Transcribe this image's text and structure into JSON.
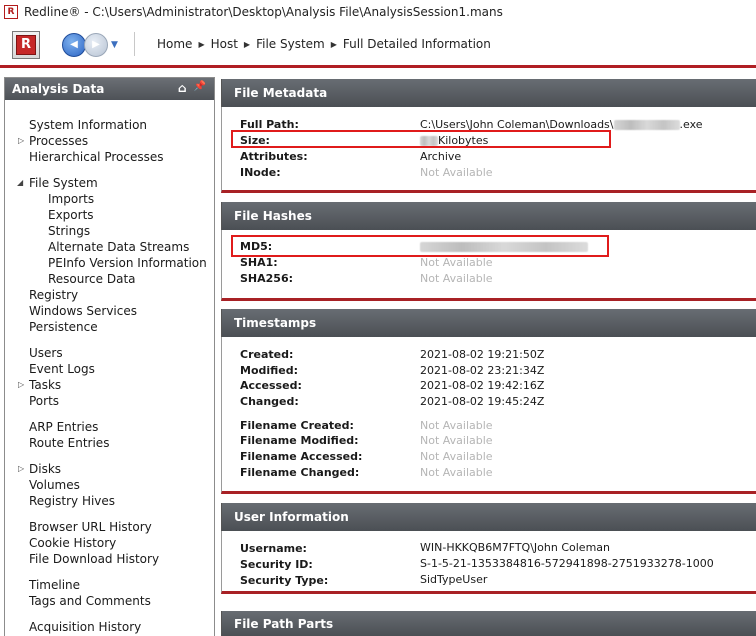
{
  "window": {
    "title": "Redline® - C:\\Users\\Administrator\\Desktop\\Analysis File\\AnalysisSession1.mans",
    "icon_letter": "R"
  },
  "toolbar": {
    "logo_letter": "R",
    "back_glyph": "◀",
    "forward_glyph": "▶",
    "dropdown_glyph": "▼",
    "breadcrumb": [
      "Home",
      "Host",
      "File System",
      "Full Detailed Information"
    ],
    "breadcrumb_sep": "▶"
  },
  "left_panel": {
    "title": "Analysis Data",
    "home_icon": "⌂",
    "pin_icon": "📌",
    "items": [
      {
        "label": "System Information"
      },
      {
        "label": "Processes",
        "expander": "▷"
      },
      {
        "label": "Hierarchical Processes"
      },
      {
        "label": "File System",
        "expander": "◢"
      },
      {
        "label": "Imports"
      },
      {
        "label": "Exports"
      },
      {
        "label": "Strings"
      },
      {
        "label": "Alternate Data Streams"
      },
      {
        "label": "PEInfo Version Information"
      },
      {
        "label": "Resource Data"
      },
      {
        "label": "Registry"
      },
      {
        "label": "Windows Services"
      },
      {
        "label": "Persistence"
      },
      {
        "label": "Users"
      },
      {
        "label": "Event Logs"
      },
      {
        "label": "Tasks",
        "expander": "▷"
      },
      {
        "label": "Ports"
      },
      {
        "label": "ARP Entries"
      },
      {
        "label": "Route Entries"
      },
      {
        "label": "Disks",
        "expander": "▷"
      },
      {
        "label": "Volumes"
      },
      {
        "label": "Registry Hives"
      },
      {
        "label": "Browser URL History"
      },
      {
        "label": "Cookie History"
      },
      {
        "label": "File Download History"
      },
      {
        "label": "Timeline"
      },
      {
        "label": "Tags and Comments"
      },
      {
        "label": "Acquisition History"
      }
    ]
  },
  "sections": {
    "metadata": {
      "title": "File Metadata",
      "full_path_label": "Full Path:",
      "full_path_prefix": "C:\\Users\\John Coleman\\Downloads\\",
      "full_path_suffix": ".exe",
      "size_label": "Size:",
      "size_unit": "Kilobytes",
      "attributes_label": "Attributes:",
      "attributes_value": "Archive",
      "inode_label": "INode:",
      "inode_value": "Not Available"
    },
    "hashes": {
      "title": "File Hashes",
      "md5_label": "MD5:",
      "sha1_label": "SHA1:",
      "sha1_value": "Not Available",
      "sha256_label": "SHA256:",
      "sha256_value": "Not Available"
    },
    "timestamps": {
      "title": "Timestamps",
      "created_label": "Created:",
      "created_value": "2021-08-02 19:21:50Z",
      "modified_label": "Modified:",
      "modified_value": "2021-08-02 23:21:34Z",
      "accessed_label": "Accessed:",
      "accessed_value": "2021-08-02 19:42:16Z",
      "changed_label": "Changed:",
      "changed_value": "2021-08-02 19:45:24Z",
      "fn_created_label": "Filename Created:",
      "fn_created_value": "Not Available",
      "fn_modified_label": "Filename Modified:",
      "fn_modified_value": "Not Available",
      "fn_accessed_label": "Filename Accessed:",
      "fn_accessed_value": "Not Available",
      "fn_changed_label": "Filename Changed:",
      "fn_changed_value": "Not Available"
    },
    "user": {
      "title": "User Information",
      "username_label": "Username:",
      "username_value": "WIN-HKKQB6M7FTQ\\John Coleman",
      "sid_label": "Security ID:",
      "sid_value": "S-1-5-21-1353384816-572941898-2751933278-1000",
      "sectype_label": "Security Type:",
      "sectype_value": "SidTypeUser"
    },
    "pathparts": {
      "title": "File Path Parts"
    }
  }
}
